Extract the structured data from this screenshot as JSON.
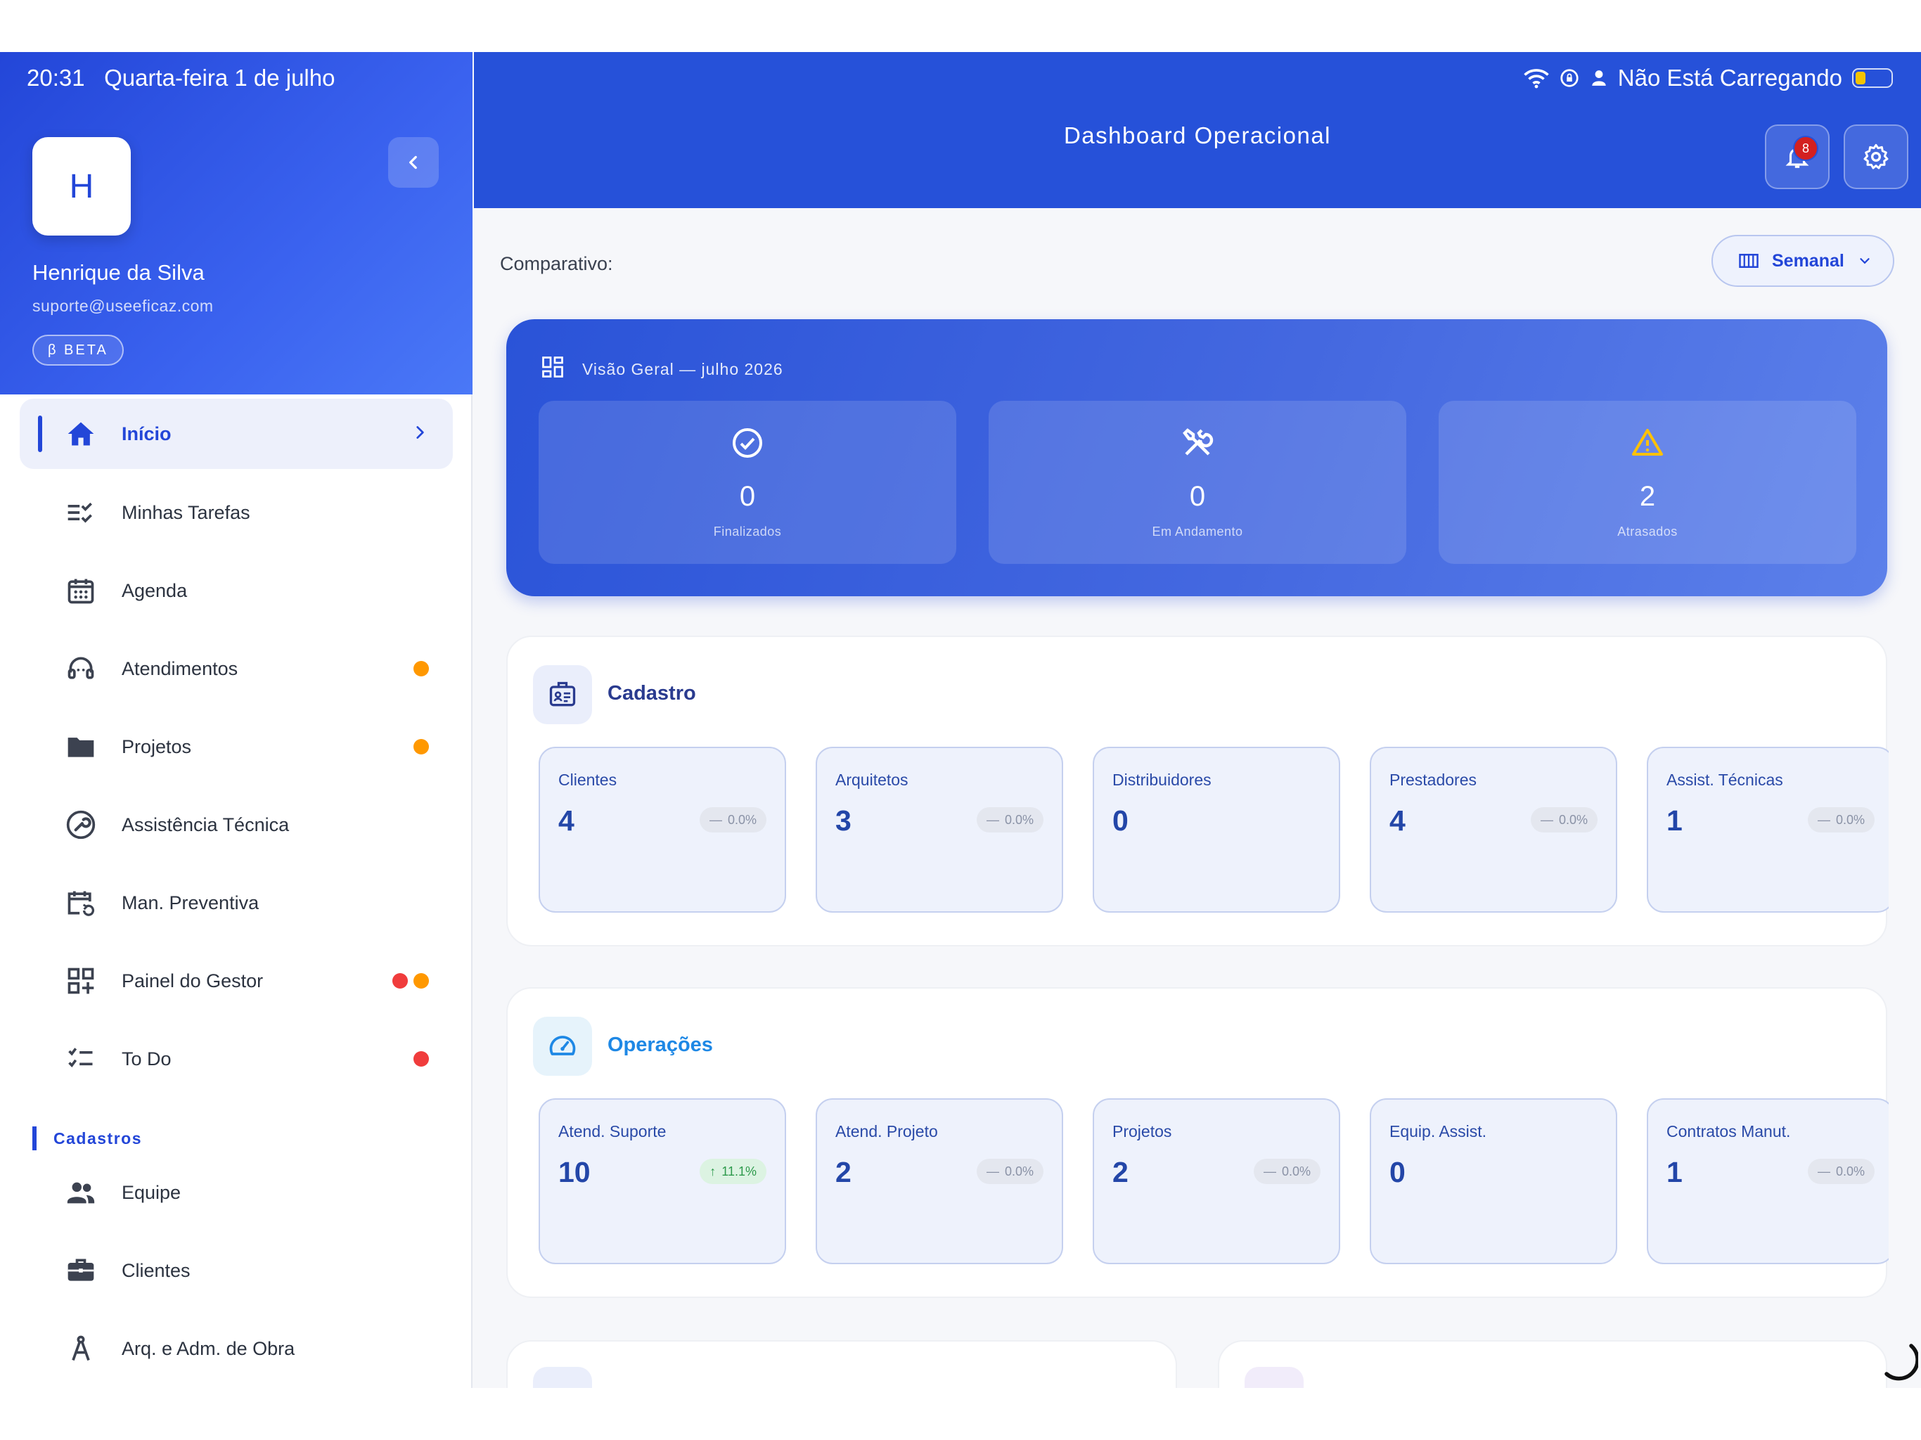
{
  "status_bar": {
    "time": "20:31",
    "date": "Quarta-feira 1 de julho",
    "battery_text": "Não Está Carregando"
  },
  "user": {
    "initial": "H",
    "name": "Henrique da Silva",
    "email": "suporte@useeficaz.com",
    "badge": "β BETA"
  },
  "nav": {
    "items": [
      {
        "label": "Início",
        "icon": "home-icon"
      },
      {
        "label": "Minhas Tarefas",
        "icon": "task-checklist-icon"
      },
      {
        "label": "Agenda",
        "icon": "calendar-icon"
      },
      {
        "label": "Atendimentos",
        "icon": "headset-icon"
      },
      {
        "label": "Projetos",
        "icon": "folder-icon"
      },
      {
        "label": "Assistência Técnica",
        "icon": "wrench-circle-icon"
      },
      {
        "label": "Man. Preventiva",
        "icon": "calendar-refresh-icon"
      },
      {
        "label": "Painel do Gestor",
        "icon": "dashboard-add-icon"
      },
      {
        "label": "To Do",
        "icon": "todo-list-icon"
      }
    ],
    "section_label": "Cadastros",
    "section_items": [
      {
        "label": "Equipe",
        "icon": "people-icon"
      },
      {
        "label": "Clientes",
        "icon": "briefcase-icon"
      },
      {
        "label": "Arq. e Adm. de Obra",
        "icon": "compass-icon"
      }
    ]
  },
  "colors": {
    "primary": "#2346d8",
    "dot_orange": "#ff9800",
    "dot_red": "#f03c3c"
  },
  "header": {
    "title": "Dashboard Operacional",
    "notification_count": "8"
  },
  "comparativo": {
    "label": "Comparativo:",
    "period": "Semanal"
  },
  "overview": {
    "title": "Visão Geral — julho 2026",
    "cards": [
      {
        "value": "0",
        "label": "Finalizados",
        "icon": "check-circle-icon"
      },
      {
        "value": "0",
        "label": "Em Andamento",
        "icon": "tools-icon"
      },
      {
        "value": "2",
        "label": "Atrasados",
        "icon": "warning-icon"
      }
    ]
  },
  "cadastro": {
    "title": "Cadastro",
    "stats": [
      {
        "label": "Clientes",
        "value": "4",
        "delta": "0.0%"
      },
      {
        "label": "Arquitetos",
        "value": "3",
        "delta": "0.0%"
      },
      {
        "label": "Distribuidores",
        "value": "0",
        "delta": ""
      },
      {
        "label": "Prestadores",
        "value": "4",
        "delta": "0.0%"
      },
      {
        "label": "Assist. Técnicas",
        "value": "1",
        "delta": "0.0%"
      }
    ]
  },
  "operacoes": {
    "title": "Operações",
    "stats": [
      {
        "label": "Atend. Suporte",
        "value": "10",
        "delta": "11.1%"
      },
      {
        "label": "Atend. Projeto",
        "value": "2",
        "delta": "0.0%"
      },
      {
        "label": "Projetos",
        "value": "2",
        "delta": "0.0%"
      },
      {
        "label": "Equip. Assist.",
        "value": "0",
        "delta": ""
      },
      {
        "label": "Contratos Manut.",
        "value": "1",
        "delta": "0.0%"
      }
    ]
  }
}
